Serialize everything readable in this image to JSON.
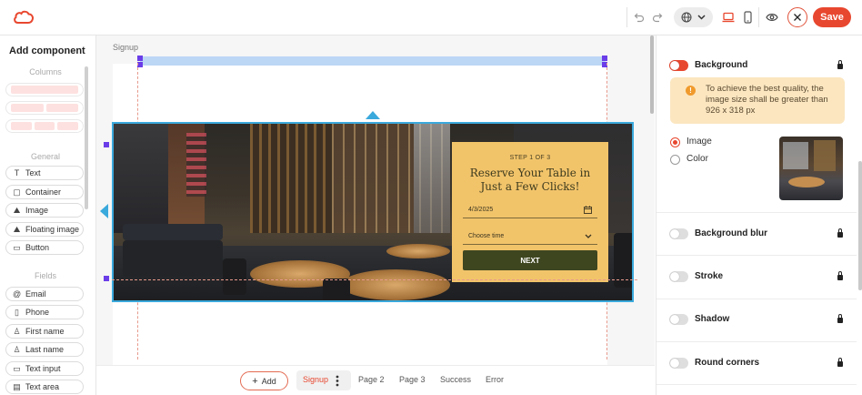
{
  "toolbar": {
    "save_label": "Save",
    "undo_icon": "undo-icon",
    "redo_icon": "redo-icon",
    "language_icon": "globe-icon",
    "desktop_icon": "laptop-icon",
    "mobile_icon": "mobile-icon",
    "preview_icon": "eye-icon",
    "close_icon": "close-icon",
    "accent_color": "#e8472f"
  },
  "left_panel": {
    "title": "Add component",
    "columns_label": "Columns",
    "general_label": "General",
    "fields_label": "Fields",
    "general_items": [
      {
        "label": "Text",
        "icon": "T"
      },
      {
        "label": "Container",
        "icon": "▢"
      },
      {
        "label": "Image",
        "icon": "⛰"
      },
      {
        "label": "Floating image",
        "icon": "⛰"
      },
      {
        "label": "Button",
        "icon": "▭"
      }
    ],
    "field_items": [
      {
        "label": "Email",
        "icon": "@"
      },
      {
        "label": "Phone",
        "icon": "▯"
      },
      {
        "label": "First name",
        "icon": "♙"
      },
      {
        "label": "Last name",
        "icon": "♙"
      },
      {
        "label": "Text input",
        "icon": "▭"
      },
      {
        "label": "Text area",
        "icon": "▤"
      }
    ]
  },
  "canvas": {
    "page_label": "Signup",
    "form": {
      "step": "STEP 1 OF 3",
      "title": "Reserve Your Table in Just a Few Clicks!",
      "date_value": "4/3/2025",
      "time_placeholder": "Choose time",
      "next_label": "NEXT",
      "card_color": "#f2c46a",
      "button_color": "#3e4620"
    }
  },
  "pages": {
    "add_label": "Add",
    "tabs": [
      "Signup",
      "Page 2",
      "Page 3",
      "Success",
      "Error"
    ],
    "active": "Signup"
  },
  "right_panel": {
    "background_label": "Background",
    "warning": "To achieve the best quality, the image size shall be greater than 926 x 318 px",
    "image_option": "Image",
    "color_option": "Color",
    "background_blur_label": "Background blur",
    "stroke_label": "Stroke",
    "shadow_label": "Shadow",
    "round_corners_label": "Round corners"
  }
}
